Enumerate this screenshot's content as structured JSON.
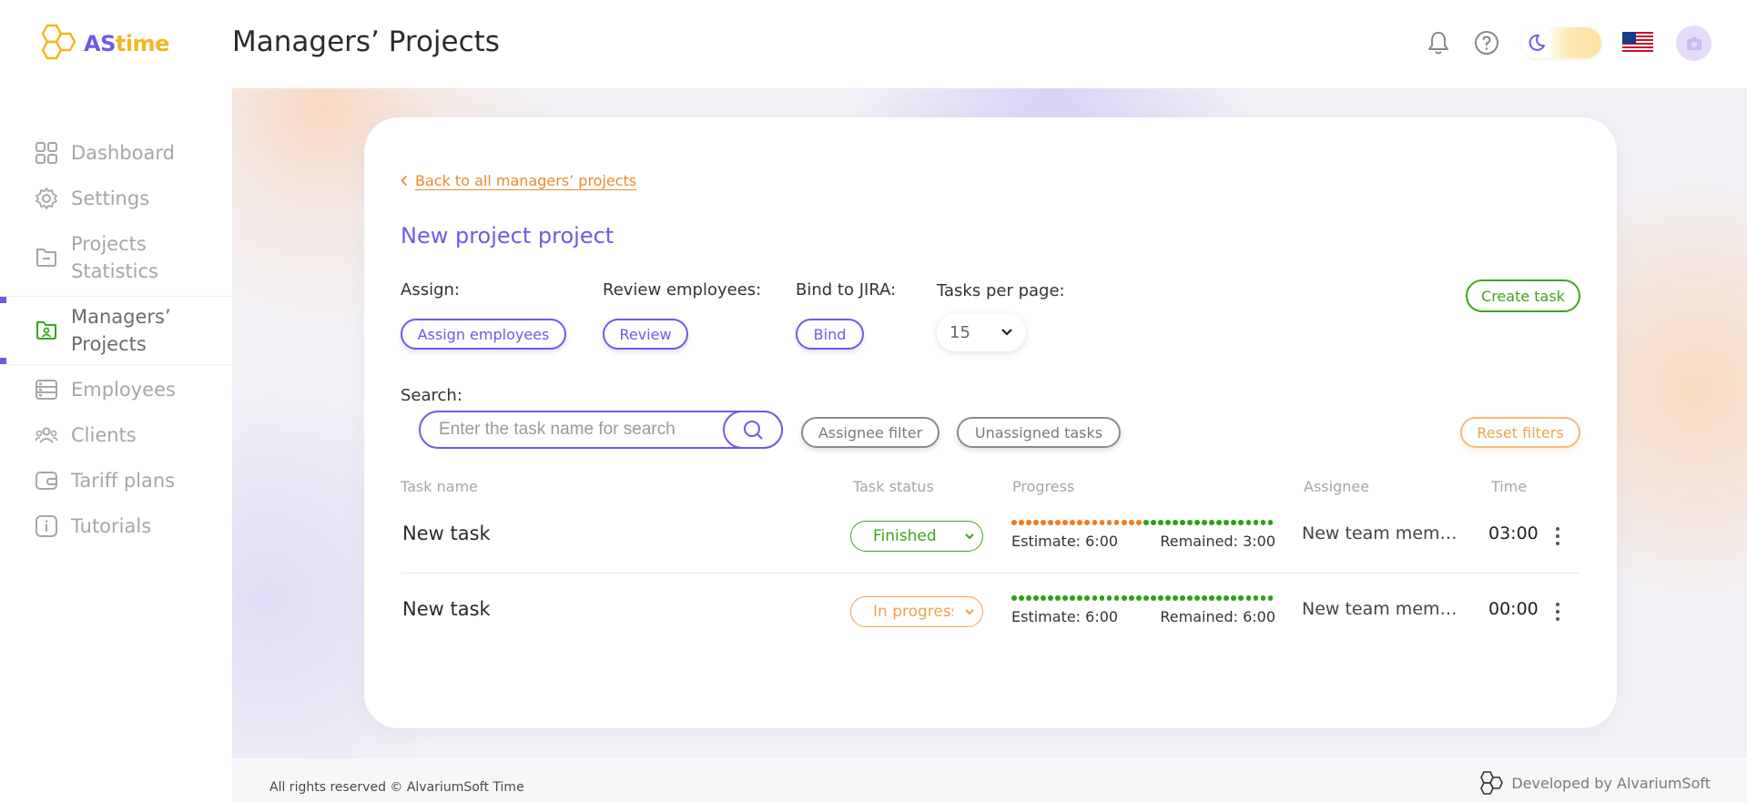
{
  "header": {
    "logo": {
      "as": "AS",
      "time": "time"
    },
    "title": "Managers’ Projects",
    "icons": [
      "bell-icon",
      "help-icon",
      "moon-icon",
      "us-flag-icon",
      "camera-icon"
    ]
  },
  "sidebar": {
    "items": [
      {
        "label": "Dashboard",
        "icon": "grid-icon"
      },
      {
        "label": "Settings",
        "icon": "gear-icon"
      },
      {
        "label": "Projects Statistics",
        "line1": "Projects",
        "line2": "Statistics",
        "icon": "folder-icon"
      },
      {
        "label": "Managers’ Projects",
        "line1": "Managers’",
        "line2": "Projects",
        "icon": "user-folder-icon",
        "active": true
      },
      {
        "label": "Employees",
        "icon": "employees-icon"
      },
      {
        "label": "Clients",
        "icon": "clients-icon"
      },
      {
        "label": "Tariff plans",
        "icon": "wallet-icon"
      },
      {
        "label": "Tutorials",
        "icon": "info-icon"
      }
    ]
  },
  "project": {
    "back_link": "Back to all managers’ projects",
    "title": "New project project",
    "assign_label": "Assign:",
    "assign_button": "Assign employees",
    "review_label": "Review employees:",
    "review_button": "Review",
    "jira_label": "Bind to JIRA:",
    "jira_button": "Bind",
    "per_page_label": "Tasks per page:",
    "per_page_value": "15",
    "create_task": "Create task",
    "search_label": "Search:",
    "search_placeholder": "Enter the task name for search",
    "assignee_filter": "Assignee filter",
    "unassigned_tasks": "Unassigned tasks",
    "reset_filters": "Reset filters"
  },
  "table": {
    "columns": [
      "Task name",
      "Task status",
      "Progress",
      "Assignee",
      "Time"
    ],
    "rows": [
      {
        "name": "New task",
        "status": "Finished",
        "status_color": "green",
        "estimate": "Estimate: 6:00",
        "remained": "Remained: 3:00",
        "progress_used_fraction": 0.5,
        "assignee": "New team member",
        "time": "03:00"
      },
      {
        "name": "New task",
        "status": "In progress",
        "status_color": "orange",
        "estimate": "Estimate: 6:00",
        "remained": "Remained: 6:00",
        "progress_used_fraction": 0.0,
        "assignee": "New team member",
        "time": "00:00"
      }
    ]
  },
  "footer": {
    "left": "All rights reserved © AlvariumSoft Time",
    "right": "Developed by AlvariumSoft"
  },
  "colors": {
    "accent": "#7457e8",
    "brand_yellow": "#f2b622",
    "success": "#3ea51b",
    "warning": "#f0a24f",
    "progress_used": "#f37a1f",
    "progress_left": "#2fa012"
  }
}
